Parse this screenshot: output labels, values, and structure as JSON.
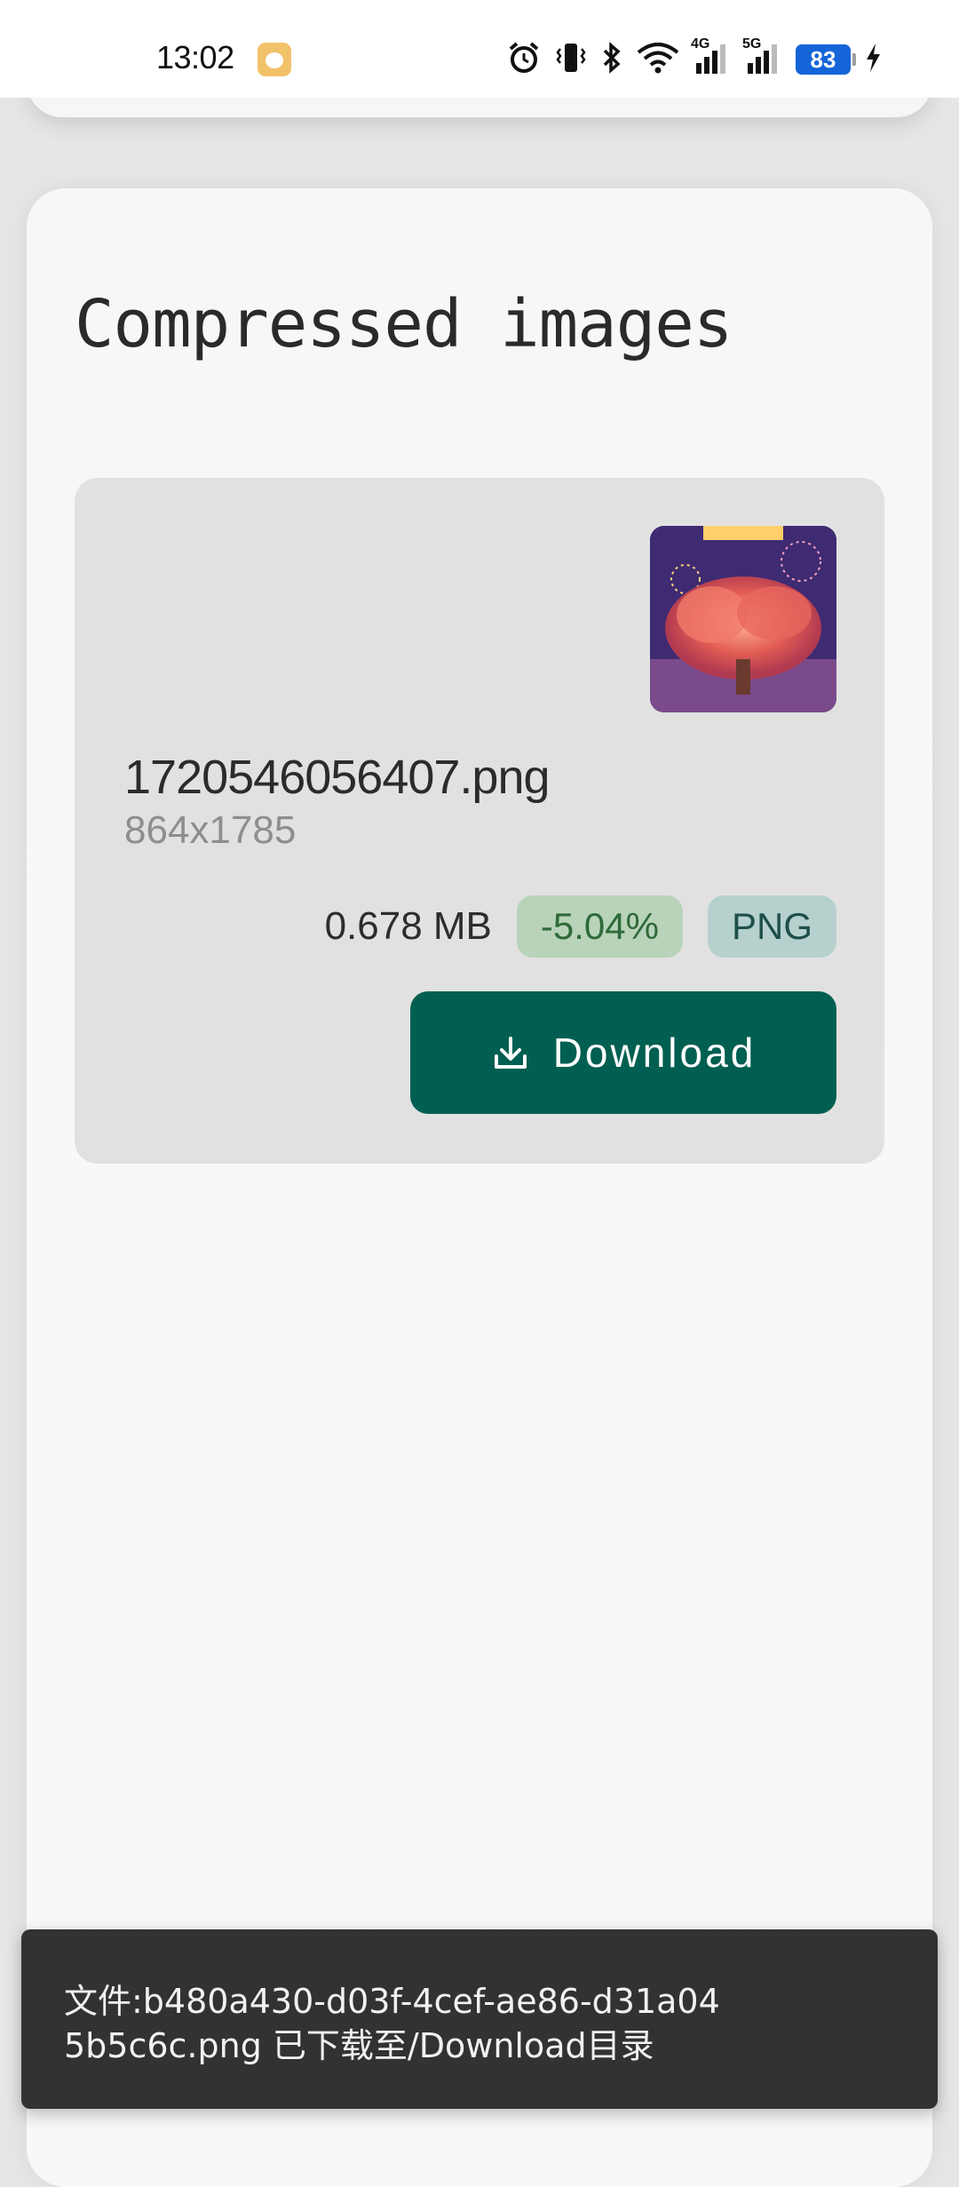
{
  "status_bar": {
    "time": "13:02",
    "net_4g": "4G",
    "net_5g": "5G",
    "battery_level": "83",
    "icons": [
      "app-notification-icon",
      "alarm-icon",
      "vibrate-icon",
      "bluetooth-icon",
      "wifi-icon",
      "signal-4g-icon",
      "signal-5g-icon",
      "battery-icon",
      "charging-icon"
    ]
  },
  "main": {
    "section_title": "Compressed images",
    "item": {
      "file_name": "1720546056407.png",
      "dimensions": "864x1785",
      "file_size": "0.678 MB",
      "ratio": "-5.04%",
      "format": "PNG",
      "download_label": "Download",
      "download_icon": "download-icon"
    }
  },
  "snackbar": {
    "message": "文件:b480a430-d03f-4cef-ae86-d31a045b5c6c.png 已下载至/Download目录"
  },
  "colors": {
    "primary": "#005f51",
    "ratio_badge_bg": "#b8d3b9",
    "format_badge_bg": "#b6d1cd",
    "item_bg": "#e1e1e1",
    "snackbar_bg": "#323232",
    "battery": "#1565d8"
  }
}
